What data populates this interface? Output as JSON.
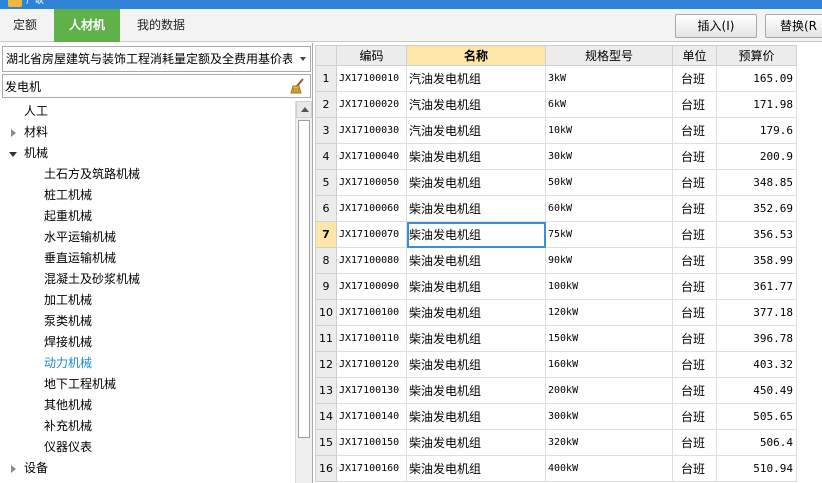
{
  "window": {
    "title": "广联"
  },
  "tabs": [
    {
      "label": "定额"
    },
    {
      "label": "人材机"
    },
    {
      "label": "我的数据"
    }
  ],
  "toolbar": {
    "insert_label": "插入(I)",
    "replace_label": "替换(R"
  },
  "library": {
    "selected": "湖北省房屋建筑与装饰工程消耗量定额及全费用基价表"
  },
  "search": {
    "value": "发电机",
    "placeholder": ""
  },
  "tree": [
    {
      "label": "人工"
    },
    {
      "label": "材料"
    },
    {
      "label": "机械"
    },
    {
      "label": "土石方及筑路机械"
    },
    {
      "label": "桩工机械"
    },
    {
      "label": "起重机械"
    },
    {
      "label": "水平运输机械"
    },
    {
      "label": "垂直运输机械"
    },
    {
      "label": "混凝土及砂浆机械"
    },
    {
      "label": "加工机械"
    },
    {
      "label": "泵类机械"
    },
    {
      "label": "焊接机械"
    },
    {
      "label": "动力机械"
    },
    {
      "label": "地下工程机械"
    },
    {
      "label": "其他机械"
    },
    {
      "label": "补充机械"
    },
    {
      "label": "仪器仪表"
    },
    {
      "label": "设备"
    }
  ],
  "grid": {
    "headers": [
      "编码",
      "名称",
      "规格型号",
      "单位",
      "预算价"
    ],
    "rows": [
      {
        "no": "1",
        "code": "JX17100010",
        "name": "汽油发电机组",
        "spec": "3kW",
        "unit": "台班",
        "price": "165.09"
      },
      {
        "no": "2",
        "code": "JX17100020",
        "name": "汽油发电机组",
        "spec": "6kW",
        "unit": "台班",
        "price": "171.98"
      },
      {
        "no": "3",
        "code": "JX17100030",
        "name": "汽油发电机组",
        "spec": "10kW",
        "unit": "台班",
        "price": "179.6"
      },
      {
        "no": "4",
        "code": "JX17100040",
        "name": "柴油发电机组",
        "spec": "30kW",
        "unit": "台班",
        "price": "200.9"
      },
      {
        "no": "5",
        "code": "JX17100050",
        "name": "柴油发电机组",
        "spec": "50kW",
        "unit": "台班",
        "price": "348.85"
      },
      {
        "no": "6",
        "code": "JX17100060",
        "name": "柴油发电机组",
        "spec": "60kW",
        "unit": "台班",
        "price": "352.69"
      },
      {
        "no": "7",
        "code": "JX17100070",
        "name": "柴油发电机组",
        "spec": "75kW",
        "unit": "台班",
        "price": "356.53"
      },
      {
        "no": "8",
        "code": "JX17100080",
        "name": "柴油发电机组",
        "spec": "90kW",
        "unit": "台班",
        "price": "358.99"
      },
      {
        "no": "9",
        "code": "JX17100090",
        "name": "柴油发电机组",
        "spec": "100kW",
        "unit": "台班",
        "price": "361.77"
      },
      {
        "no": "10",
        "code": "JX17100100",
        "name": "柴油发电机组",
        "spec": "120kW",
        "unit": "台班",
        "price": "377.18"
      },
      {
        "no": "11",
        "code": "JX17100110",
        "name": "柴油发电机组",
        "spec": "150kW",
        "unit": "台班",
        "price": "396.78"
      },
      {
        "no": "12",
        "code": "JX17100120",
        "name": "柴油发电机组",
        "spec": "160kW",
        "unit": "台班",
        "price": "403.32"
      },
      {
        "no": "13",
        "code": "JX17100130",
        "name": "柴油发电机组",
        "spec": "200kW",
        "unit": "台班",
        "price": "450.49"
      },
      {
        "no": "14",
        "code": "JX17100140",
        "name": "柴油发电机组",
        "spec": "300kW",
        "unit": "台班",
        "price": "505.65"
      },
      {
        "no": "15",
        "code": "JX17100150",
        "name": "柴油发电机组",
        "spec": "320kW",
        "unit": "台班",
        "price": "506.4"
      },
      {
        "no": "16",
        "code": "JX17100160",
        "name": "柴油发电机组",
        "spec": "400kW",
        "unit": "台班",
        "price": "510.94"
      }
    ]
  },
  "colors": {
    "active_tab": "#5fb14a",
    "header_highlight": "#fde7a8",
    "selected_node": "#1e8bd3",
    "titlebar": "#2e83d6"
  }
}
